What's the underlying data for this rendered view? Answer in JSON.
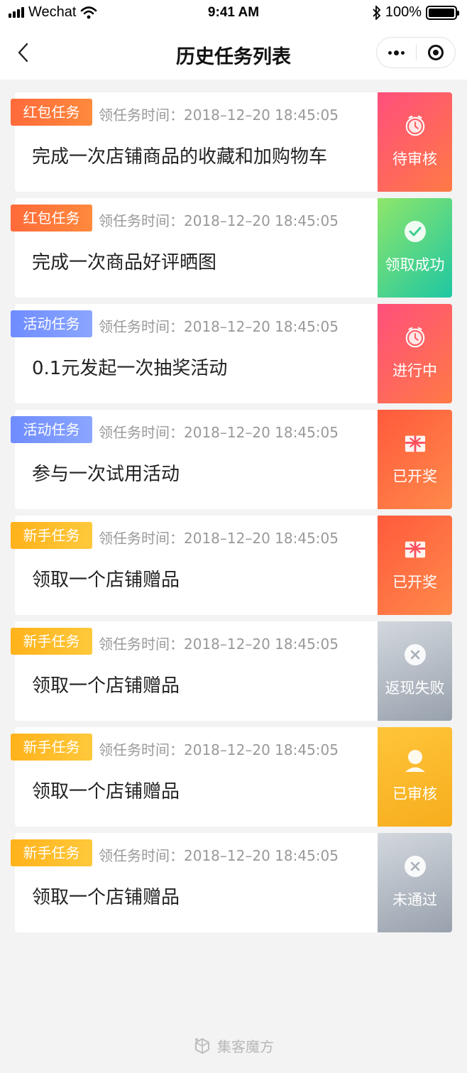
{
  "status_bar": {
    "carrier": "Wechat",
    "time": "9:41 AM",
    "battery": "100%"
  },
  "nav": {
    "title": "历史任务列表"
  },
  "tasks": [
    {
      "tag": "红包任务",
      "tag_color": "red",
      "time": "领任务时间：2018–12–20 18:45:05",
      "title": "完成一次店铺商品的收藏和加购物车",
      "status": "待审核",
      "status_style": "pending",
      "icon": "clock-icon"
    },
    {
      "tag": "红包任务",
      "tag_color": "red",
      "time": "领任务时间：2018–12–20 18:45:05",
      "title": "完成一次商品好评晒图",
      "status": "领取成功",
      "status_style": "success",
      "icon": "check-icon"
    },
    {
      "tag": "活动任务",
      "tag_color": "blue",
      "time": "领任务时间：2018–12–20 18:45:05",
      "title": "0.1元发起一次抽奖活动",
      "status": "进行中",
      "status_style": "progress",
      "icon": "clock-icon"
    },
    {
      "tag": "活动任务",
      "tag_color": "blue",
      "time": "领任务时间：2018–12–20 18:45:05",
      "title": "参与一次试用活动",
      "status": "已开奖",
      "status_style": "drawn",
      "icon": "gift-icon"
    },
    {
      "tag": "新手任务",
      "tag_color": "yellow",
      "time": "领任务时间：2018–12–20 18:45:05",
      "title": "领取一个店铺赠品",
      "status": "已开奖",
      "status_style": "drawn",
      "icon": "gift-icon"
    },
    {
      "tag": "新手任务",
      "tag_color": "yellow",
      "time": "领任务时间：2018–12–20 18:45:05",
      "title": "领取一个店铺赠品",
      "status": "返现失败",
      "status_style": "failed",
      "icon": "x-icon"
    },
    {
      "tag": "新手任务",
      "tag_color": "yellow",
      "time": "领任务时间：2018–12–20 18:45:05",
      "title": "领取一个店铺赠品",
      "status": "已审核",
      "status_style": "reviewed",
      "icon": "person-icon"
    },
    {
      "tag": "新手任务",
      "tag_color": "yellow",
      "time": "领任务时间：2018–12–20 18:45:05",
      "title": "领取一个店铺赠品",
      "status": "未通过",
      "status_style": "failed",
      "icon": "x-icon"
    }
  ],
  "footer": {
    "brand": "集客魔方"
  }
}
